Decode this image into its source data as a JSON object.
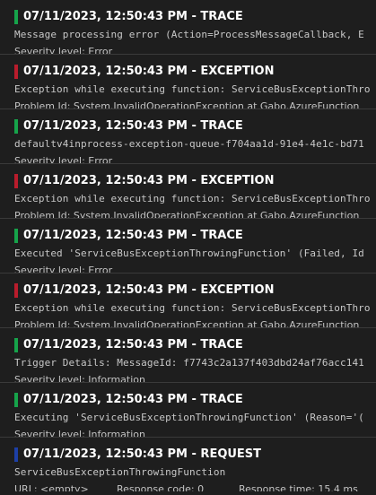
{
  "colors": {
    "trace": "#16a34a",
    "exception": "#b91c2c",
    "request": "#1d3fa6"
  },
  "entries": [
    {
      "level": "trace",
      "header": "07/11/2023, 12:50:43 PM - TRACE",
      "message": "Message processing error (Action=ProcessMessageCallback, E",
      "detail_label": "Severity level:",
      "detail_value": "Error"
    },
    {
      "level": "exception",
      "header": "07/11/2023, 12:50:43 PM - EXCEPTION",
      "message": "Exception while executing function: ServiceBusExceptionThro",
      "detail_label": "Problem Id:",
      "detail_value": "System.InvalidOperationException at Gabo.AzureFunction"
    },
    {
      "level": "trace",
      "header": "07/11/2023, 12:50:43 PM - TRACE",
      "message": "defaultv4inprocess-exception-queue-f704aa1d-91e4-4e1c-bd71",
      "detail_label": "Severity level:",
      "detail_value": "Error"
    },
    {
      "level": "exception",
      "header": "07/11/2023, 12:50:43 PM - EXCEPTION",
      "message": "Exception while executing function: ServiceBusExceptionThro",
      "detail_label": "Problem Id:",
      "detail_value": "System.InvalidOperationException at Gabo.AzureFunction"
    },
    {
      "level": "trace",
      "header": "07/11/2023, 12:50:43 PM - TRACE",
      "message": "Executed 'ServiceBusExceptionThrowingFunction' (Failed, Id",
      "detail_label": "Severity level:",
      "detail_value": "Error"
    },
    {
      "level": "exception",
      "header": "07/11/2023, 12:50:43 PM - EXCEPTION",
      "message": "Exception while executing function: ServiceBusExceptionThro",
      "detail_label": "Problem Id:",
      "detail_value": "System.InvalidOperationException at Gabo.AzureFunction"
    },
    {
      "level": "trace",
      "header": "07/11/2023, 12:50:43 PM - TRACE",
      "message": "Trigger Details: MessageId: f7743c2a137f403dbd24af76acc141",
      "detail_label": "Severity level:",
      "detail_value": "Information"
    },
    {
      "level": "trace",
      "header": "07/11/2023, 12:50:43 PM - TRACE",
      "message": "Executing 'ServiceBusExceptionThrowingFunction' (Reason='(",
      "detail_label": "Severity level:",
      "detail_value": "Information"
    }
  ],
  "request": {
    "level": "request",
    "header": "07/11/2023, 12:50:43 PM - REQUEST",
    "message": "ServiceBusExceptionThrowingFunction",
    "url_label": "URL:",
    "url_value": "<empty>",
    "code_label": "Response code:",
    "code_value": "0",
    "time_label": "Response time:",
    "time_value": "15.4 ms"
  }
}
